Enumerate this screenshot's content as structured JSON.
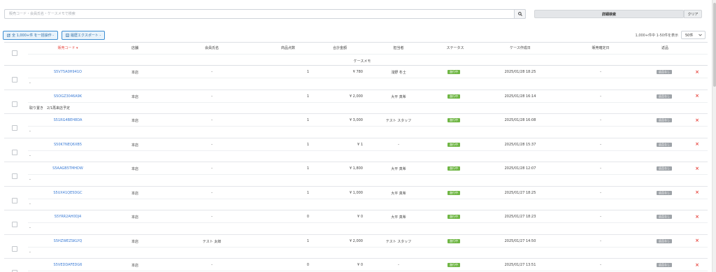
{
  "search": {
    "placeholder": "販売コード・会員氏名・ケースメモで検索",
    "value": ""
  },
  "buttons": {
    "advanced_search": "詳細検索",
    "clear": "クリア",
    "bulk_action": "全 1,000+件 を一括操作 -",
    "export": "履歴エクスポート -"
  },
  "pagination": {
    "range_text": "1,000+件中 1-50件を表示",
    "per_page": "50件"
  },
  "columns": {
    "code": "販売コード",
    "store": "店舗",
    "member": "会員氏名",
    "items": "商品点数",
    "total": "合計金額",
    "staff": "担当者",
    "status": "ステータス",
    "created": "ケース作成日",
    "confirmed": "販売確定日",
    "returns": "返品",
    "memo": "ケースメモ"
  },
  "rows": [
    {
      "code": "S5V75A0H941O",
      "store": "本店",
      "member": "-",
      "items": "1",
      "total": "¥ 780",
      "staff": "浅野 冬士",
      "status": "進行中",
      "created": "2025/01/28 18:25",
      "confirmed": "-",
      "returns": "返品なし",
      "memo": "-"
    },
    {
      "code": "S5OGZ3046A9K",
      "store": "本店",
      "member": "-",
      "items": "1",
      "total": "¥ 2,000",
      "staff": "大平 真希",
      "status": "進行中",
      "created": "2025/01/28 16:14",
      "confirmed": "-",
      "returns": "返品なし",
      "memo": "取り置き　2/1再来店予定"
    },
    {
      "code": "S51RG4BEH8DA",
      "store": "本店",
      "member": "-",
      "items": "1",
      "total": "¥ 3,000",
      "staff": "テスト スタッフ",
      "status": "進行中",
      "created": "2025/01/28 16:08",
      "confirmed": "-",
      "returns": "返品なし",
      "memo": "-"
    },
    {
      "code": "S50K7NEQ6XB5",
      "store": "本店",
      "member": "-",
      "items": "1",
      "total": "¥ 1",
      "staff": "-",
      "status": "進行中",
      "created": "2025/01/28 15:37",
      "confirmed": "-",
      "returns": "返品なし",
      "memo": "-"
    },
    {
      "code": "S5AAGB5TMHDW",
      "store": "本店",
      "member": "-",
      "items": "1",
      "total": "¥ 1,800",
      "staff": "大平 真希",
      "status": "進行中",
      "created": "2025/01/28 12:07",
      "confirmed": "-",
      "returns": "返品なし",
      "memo": "-"
    },
    {
      "code": "S5UX41QE5DGC",
      "store": "本店",
      "member": "-",
      "items": "1",
      "total": "¥ 1,000",
      "staff": "大平 真希",
      "status": "進行中",
      "created": "2025/01/27 18:25",
      "confirmed": "-",
      "returns": "返品なし",
      "memo": "-"
    },
    {
      "code": "S5YRR2AH0DJ4",
      "store": "本店",
      "member": "-",
      "items": "0",
      "total": "¥ 0",
      "staff": "大平 真希",
      "status": "進行中",
      "created": "2025/01/27 18:23",
      "confirmed": "-",
      "returns": "返品なし",
      "memo": "-"
    },
    {
      "code": "S5HZWEZSKLYQ",
      "store": "本店",
      "member": "テスト 太郎",
      "items": "1",
      "total": "¥ 2,000",
      "staff": "テスト スタッフ",
      "status": "進行中",
      "created": "2025/01/27 14:50",
      "confirmed": "-",
      "returns": "返品なし",
      "memo": "-"
    },
    {
      "code": "S5VEDDAFEDG6",
      "store": "本店",
      "member": "-",
      "items": "0",
      "total": "¥ 0",
      "staff": "-",
      "status": "進行中",
      "created": "2025/01/27 13:51",
      "confirmed": "-",
      "returns": "返品なし",
      "memo": ""
    }
  ],
  "colors": {
    "link": "#3a7bd5",
    "status_ok": "#6fb644",
    "delete": "#e84a43",
    "return_badge": "#9ea3a8",
    "active_sort": "#e84a43"
  },
  "icons": {
    "search": "search-icon",
    "edit": "edit-icon",
    "delete": "delete-icon",
    "sort": "sort-desc-icon",
    "select": "chevron-down-icon"
  }
}
